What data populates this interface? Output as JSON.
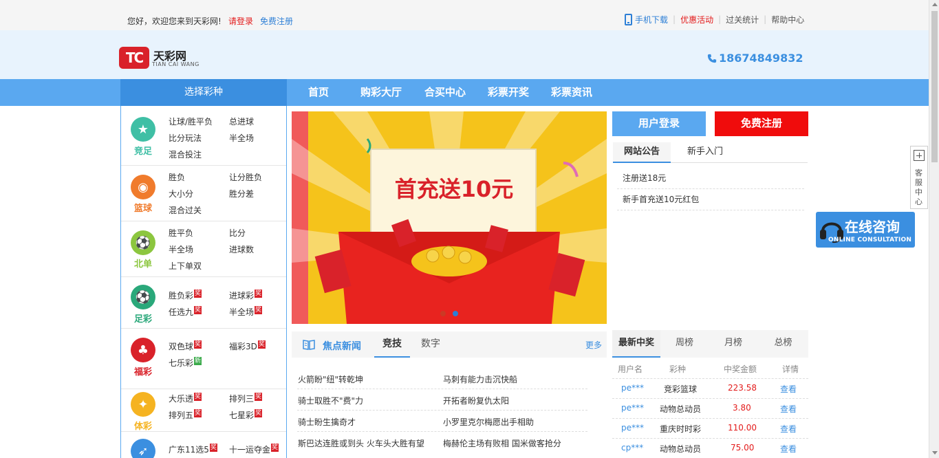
{
  "topbar": {
    "welcome": "您好，欢迎您来到天彩网!",
    "login": "请登录",
    "register": "免费注册",
    "links": {
      "mobile": "手机下载",
      "promo": "优惠活动",
      "stats": "过关统计",
      "help": "帮助中心"
    }
  },
  "header": {
    "logo_mark": "TC",
    "logo_name": "天彩网",
    "logo_sub": "TIAN CAI WANG",
    "hotline": "18674849832"
  },
  "nav": {
    "select": "选择彩种",
    "items": [
      "首页",
      "购彩大厅",
      "合买中心",
      "彩票开奖",
      "彩票资讯"
    ]
  },
  "categories": [
    {
      "name": "竞足",
      "icon": "soccer-star-icon",
      "color": "#3fbfa5",
      "games": [
        "让球/胜平负",
        "总进球",
        "比分玩法",
        "半全场",
        "混合投注"
      ]
    },
    {
      "name": "篮球",
      "icon": "basketball-icon",
      "color": "#f07b2c",
      "games": [
        "胜负",
        "让分胜负",
        "大小分",
        "胜分差",
        "混合过关"
      ]
    },
    {
      "name": "北单",
      "icon": "soccer-icon",
      "color": "#8cc63f",
      "games": [
        "胜平负",
        "比分",
        "半全场",
        "进球数",
        "上下单双"
      ]
    },
    {
      "name": "足彩",
      "icon": "football-icon",
      "color": "#2aa87a",
      "games": [
        "胜负彩",
        "进球彩",
        "任选九",
        "半全场"
      ],
      "badge": "奖"
    },
    {
      "name": "福彩",
      "icon": "clover-icon",
      "color": "#d9222a",
      "games": [
        "双色球",
        "福彩3D",
        "七乐彩"
      ],
      "badge": "奖",
      "badge_new": "新"
    },
    {
      "name": "体彩",
      "icon": "sport-icon",
      "color": "#f5b321",
      "games": [
        "大乐透",
        "排列三",
        "排列五",
        "七星彩"
      ],
      "badge": "奖"
    },
    {
      "name": "",
      "icon": "rocket-icon",
      "color": "#3b8fe0",
      "games": [
        "广东11选5",
        "十一运夺金"
      ],
      "badge": "奖"
    }
  ],
  "banner": {
    "headline": "首充送10元",
    "colors": {
      "bg": "#f5c31b",
      "envelope": "#e8231f",
      "text": "#d9222a"
    }
  },
  "auth": {
    "login": "用户登录",
    "register": "免费注册"
  },
  "notice": {
    "tabs": [
      "网站公告",
      "新手入门"
    ],
    "items": [
      "注册送18元",
      "新手首充送10元红包"
    ]
  },
  "news": {
    "title": "焦点新闻",
    "tabs": [
      "竞技",
      "数字"
    ],
    "more": "更多",
    "items": [
      [
        "火箭盼\"纽\"转乾坤",
        "马刺有能力击沉快船"
      ],
      [
        "骑士取胜不\"费\"力",
        "开拓者盼复仇太阳"
      ],
      [
        "骑士盼生擒奇才",
        "小罗里克尔梅愿出手相助"
      ],
      [
        "斯巴达连胜或到头 火车头大胜有望",
        "梅赫伦主场有败相 国米做客抢分"
      ]
    ]
  },
  "winners": {
    "tabs": [
      "最新中奖",
      "周榜",
      "月榜",
      "总榜"
    ],
    "columns": [
      "用户名",
      "彩种",
      "中奖金额",
      "详情"
    ],
    "rows": [
      {
        "user": "pe***",
        "lottery": "竞彩篮球",
        "amount": "223.58",
        "detail": "查看"
      },
      {
        "user": "pe***",
        "lottery": "动物总动员",
        "amount": "3.80",
        "detail": "查看"
      },
      {
        "user": "pe***",
        "lottery": "重庆时时彩",
        "amount": "110.00",
        "detail": "查看"
      },
      {
        "user": "cp***",
        "lottery": "动物总动员",
        "amount": "75.00",
        "detail": "查看"
      }
    ]
  },
  "float": {
    "service": "客服中心",
    "consult_big": "在线咨询",
    "consult_small": "ONLINE CONSULTATION"
  }
}
